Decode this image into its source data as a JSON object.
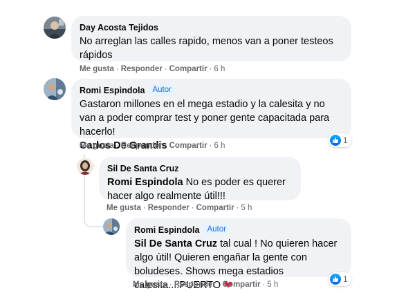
{
  "comments": [
    {
      "author": "Day Acosta Tejidos",
      "text": "No arreglan las calles rapido, menos van a poner testeos rápidos",
      "actions": {
        "like": "Me gusta",
        "reply": "Responder",
        "share": "Compartir",
        "time": "6 h"
      }
    },
    {
      "author": "Romi Espindola",
      "badge": "Autor",
      "text": "Gastaron millones en el mega estadio y la calesita y no van a poder comprar test y poner gente capacitada para hacerlo!",
      "mention": "Carlos De Grandis",
      "actions": {
        "like": "Me gusta",
        "reply": "Responder",
        "share": "Compartir",
        "time": "6 h"
      },
      "reactions": {
        "count": "1"
      }
    },
    {
      "author": "Sil De Santa Cruz",
      "mention": "Romi Espindola",
      "text": " No es poder es querer hacer algo realmente útil!!!",
      "actions": {
        "like": "Me gusta",
        "reply": "Responder",
        "share": "Compartir",
        "time": "5 h"
      }
    },
    {
      "author": "Romi Espindola",
      "badge": "Autor",
      "mention": "Sil De Santa Cruz",
      "text": " tal cual ! No quieren hacer algo útil! Quieren engañar la gente con boludeses. Shows mega estadios calesita....PUERTO ",
      "emoji": "❤",
      "actions": {
        "like": "Me gusta",
        "reply": "Responder",
        "share": "Compartir",
        "time": "5 h"
      },
      "reactions": {
        "count": "1"
      }
    }
  ],
  "separator": "·",
  "colors": {
    "bubble": "#f0f2f5",
    "meta": "#65676b",
    "badge_text": "#216fdb",
    "badge_bg": "#e7f3ff",
    "heart": "#e41e3f",
    "like": "#1877f2"
  }
}
